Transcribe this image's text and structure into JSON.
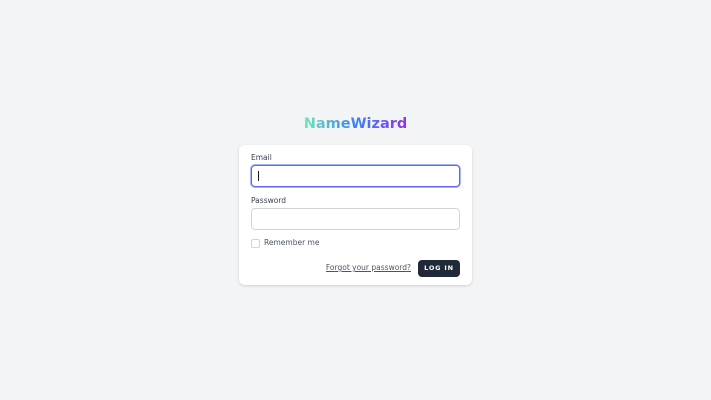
{
  "brand": {
    "name": "NameWizard"
  },
  "form": {
    "email_label": "Email",
    "email_value": "",
    "password_label": "Password",
    "password_value": "",
    "remember_label": "Remember me",
    "remember_checked": false,
    "forgot_link": "Forgot your password?",
    "login_button": "LOG IN"
  },
  "colors": {
    "page_background": "#f3f4f6",
    "card_background": "#ffffff",
    "focus_ring": "#6366f1",
    "button_background": "#1f2937",
    "brand_gradient": [
      "#6ee7b7",
      "#3b82f6",
      "#9333ea"
    ]
  }
}
